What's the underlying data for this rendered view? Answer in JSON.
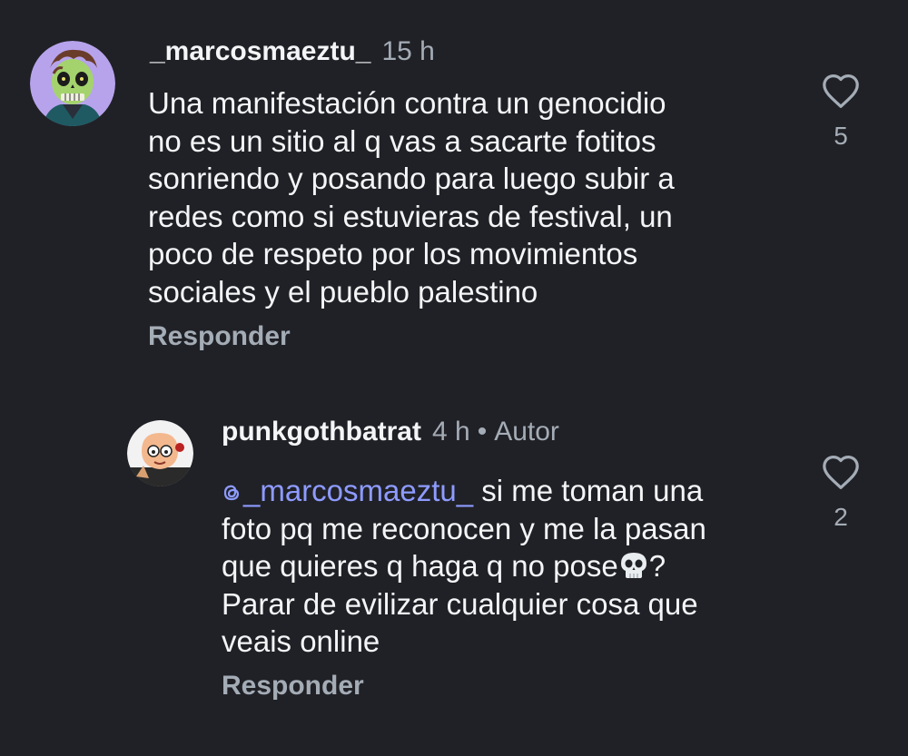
{
  "comments": [
    {
      "username": "_marcosmaeztu_",
      "time": "15 h",
      "lines": [
        "Una manifestación contra un genocidio",
        "no es un sitio al q vas a sacarte fotitos",
        "sonriendo y posando para luego subir a",
        "redes como si estuvieras de festival, un",
        "poco de respeto por los movimientos",
        "sociales y el pueblo palestino"
      ],
      "reply_label": "Responder",
      "likes": "5"
    },
    {
      "username": "punkgothbatrat",
      "time": "4 h",
      "dot": "•",
      "author_label": "Autor",
      "mention": "_marcosmaeztu_",
      "line1_rest": " si me toman una",
      "line2": "foto pq me reconocen y me la pasan",
      "line3_text": "que quieres q haga q no pose",
      "line3_end": "?",
      "line4": "Parar de evilizar cualquier cosa que",
      "line5": "veais online",
      "reply_label": "Responder",
      "likes": "2"
    }
  ],
  "icons": {
    "like": "heart-outline-icon",
    "skull": "skull-emoji-icon",
    "threads_mention": "threads-at-icon"
  },
  "colors": {
    "background": "#202126",
    "text": "#f3f5f7",
    "secondary": "#a4acb6",
    "mention": "#8e9bff",
    "avatar1_bg": "#b9a6ee"
  }
}
